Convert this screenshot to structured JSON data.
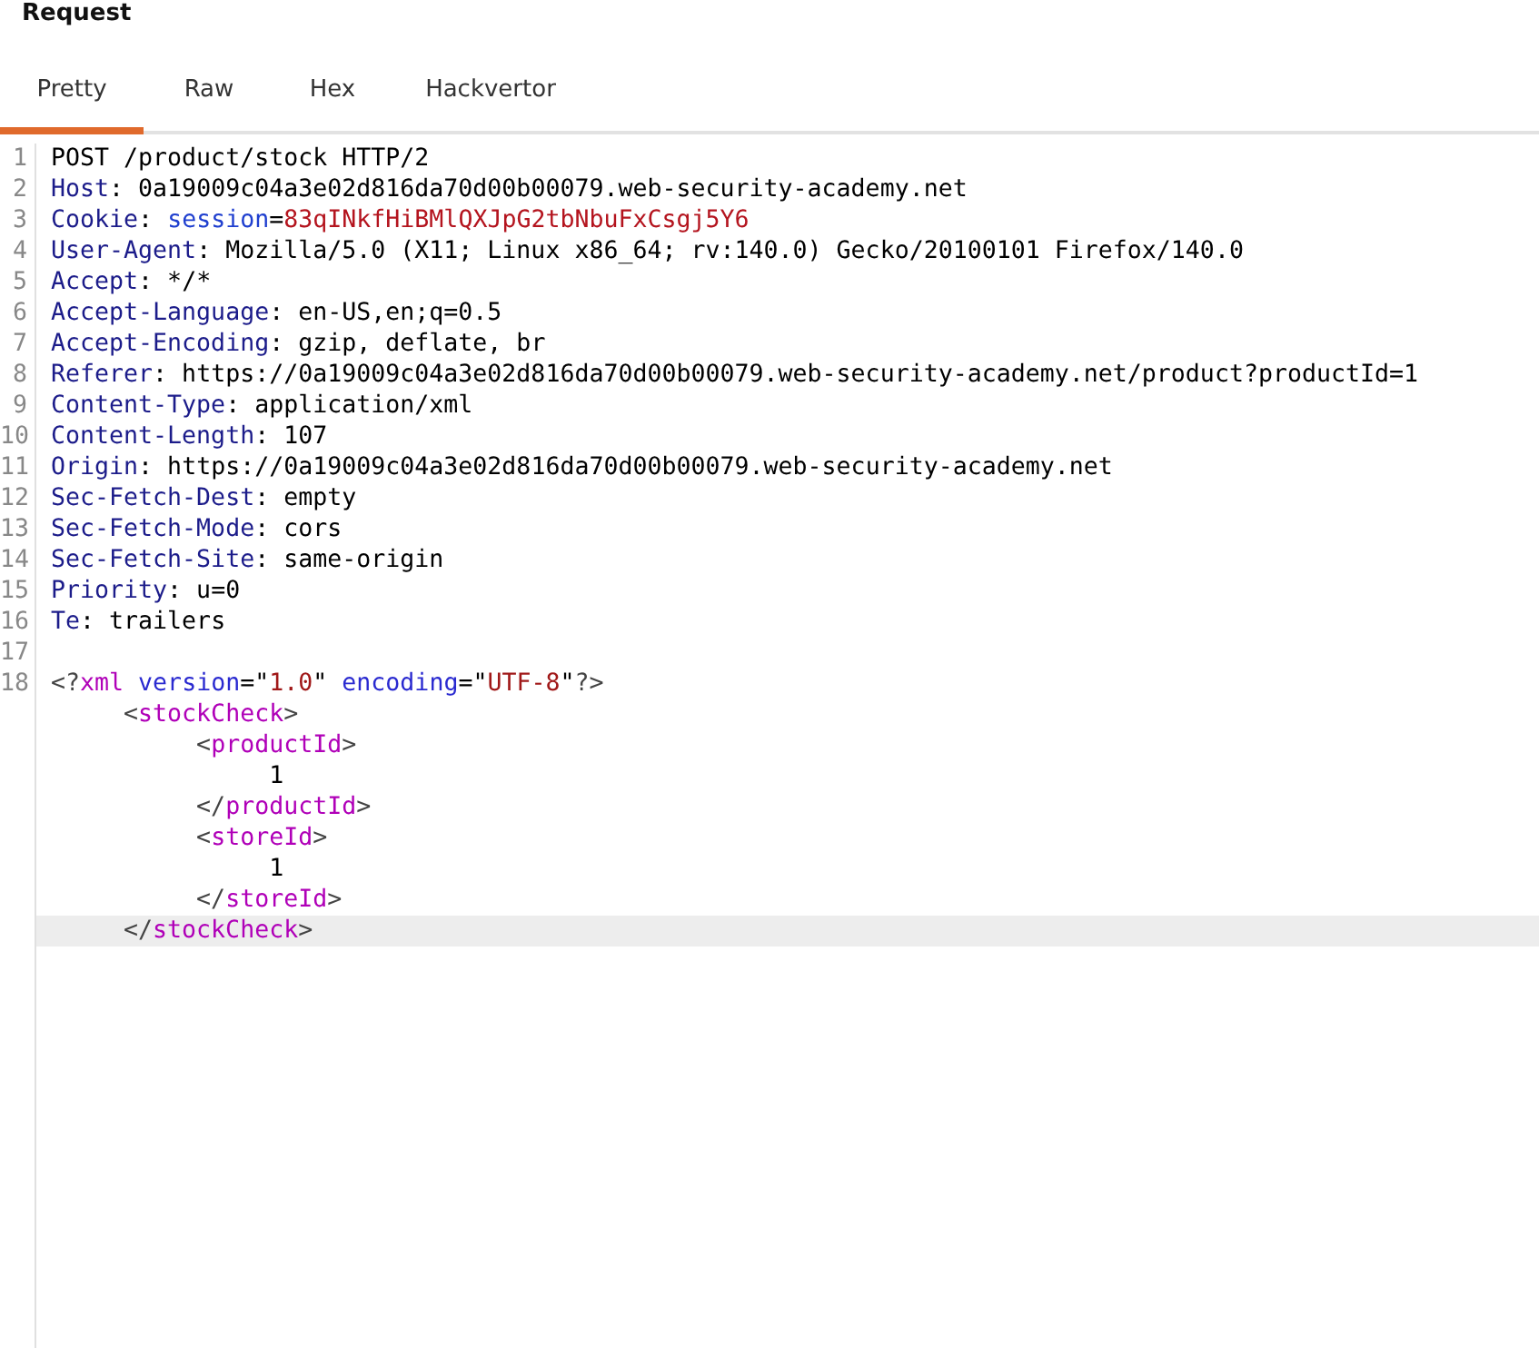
{
  "panel": {
    "title": "Request"
  },
  "tabs": [
    {
      "label": "Pretty",
      "selected": true
    },
    {
      "label": "Raw",
      "selected": false
    },
    {
      "label": "Hex",
      "selected": false
    },
    {
      "label": "Hackvertor",
      "selected": false
    }
  ],
  "editor": {
    "lines": [
      {
        "number": "1",
        "current": false,
        "tokens": [
          {
            "kind": "plain",
            "text": "POST /product/stock HTTP/2"
          }
        ]
      },
      {
        "number": "2",
        "current": false,
        "tokens": [
          {
            "kind": "key",
            "text": "Host"
          },
          {
            "kind": "plain",
            "text": ": 0a19009c04a3e02d816da70d00b00079.web-security-academy.net"
          }
        ]
      },
      {
        "number": "3",
        "current": false,
        "tokens": [
          {
            "kind": "key",
            "text": "Cookie"
          },
          {
            "kind": "plain",
            "text": ": "
          },
          {
            "kind": "cookie-name",
            "text": "session"
          },
          {
            "kind": "plain",
            "text": "="
          },
          {
            "kind": "cookie-value",
            "text": "83qINkfHiBMlQXJpG2tbNbuFxCsgj5Y6"
          }
        ]
      },
      {
        "number": "4",
        "current": false,
        "tokens": [
          {
            "kind": "key",
            "text": "User-Agent"
          },
          {
            "kind": "plain",
            "text": ": Mozilla/5.0 (X11; Linux x86_64; rv:140.0) Gecko/20100101 Firefox/140.0"
          }
        ]
      },
      {
        "number": "5",
        "current": false,
        "tokens": [
          {
            "kind": "key",
            "text": "Accept"
          },
          {
            "kind": "plain",
            "text": ": */*"
          }
        ]
      },
      {
        "number": "6",
        "current": false,
        "tokens": [
          {
            "kind": "key",
            "text": "Accept-Language"
          },
          {
            "kind": "plain",
            "text": ": en-US,en;q=0.5"
          }
        ]
      },
      {
        "number": "7",
        "current": false,
        "tokens": [
          {
            "kind": "key",
            "text": "Accept-Encoding"
          },
          {
            "kind": "plain",
            "text": ": gzip, deflate, br"
          }
        ]
      },
      {
        "number": "8",
        "current": false,
        "tokens": [
          {
            "kind": "key",
            "text": "Referer"
          },
          {
            "kind": "plain",
            "text": ": https://0a19009c04a3e02d816da70d00b00079.web-security-academy.net/product?productId=1"
          }
        ]
      },
      {
        "number": "9",
        "current": false,
        "tokens": [
          {
            "kind": "key",
            "text": "Content-Type"
          },
          {
            "kind": "plain",
            "text": ": application/xml"
          }
        ]
      },
      {
        "number": "10",
        "current": false,
        "tokens": [
          {
            "kind": "key",
            "text": "Content-Length"
          },
          {
            "kind": "plain",
            "text": ": 107"
          }
        ]
      },
      {
        "number": "11",
        "current": false,
        "tokens": [
          {
            "kind": "key",
            "text": "Origin"
          },
          {
            "kind": "plain",
            "text": ": https://0a19009c04a3e02d816da70d00b00079.web-security-academy.net"
          }
        ]
      },
      {
        "number": "12",
        "current": false,
        "tokens": [
          {
            "kind": "key",
            "text": "Sec-Fetch-Dest"
          },
          {
            "kind": "plain",
            "text": ": empty"
          }
        ]
      },
      {
        "number": "13",
        "current": false,
        "tokens": [
          {
            "kind": "key",
            "text": "Sec-Fetch-Mode"
          },
          {
            "kind": "plain",
            "text": ": cors"
          }
        ]
      },
      {
        "number": "14",
        "current": false,
        "tokens": [
          {
            "kind": "key",
            "text": "Sec-Fetch-Site"
          },
          {
            "kind": "plain",
            "text": ": same-origin"
          }
        ]
      },
      {
        "number": "15",
        "current": false,
        "tokens": [
          {
            "kind": "key",
            "text": "Priority"
          },
          {
            "kind": "plain",
            "text": ": u=0"
          }
        ]
      },
      {
        "number": "16",
        "current": false,
        "tokens": [
          {
            "kind": "key",
            "text": "Te"
          },
          {
            "kind": "plain",
            "text": ": trailers"
          }
        ]
      },
      {
        "number": "17",
        "current": false
      },
      {
        "number": "18",
        "current": false,
        "tokens": [
          {
            "kind": "bracket",
            "text": "<?"
          },
          {
            "kind": "tag",
            "text": "xml"
          },
          {
            "kind": "attr",
            "text": "version"
          },
          {
            "kind": "plain",
            "text": "=\""
          },
          {
            "kind": "string",
            "text": "1.0"
          },
          {
            "kind": "plain",
            "text": "\" "
          },
          {
            "kind": "attr",
            "text": "encoding"
          },
          {
            "kind": "plain",
            "text": "=\""
          },
          {
            "kind": "string",
            "text": "UTF-8"
          },
          {
            "kind": "plain",
            "text": "\""
          },
          {
            "kind": "bracket",
            "text": "?>"
          }
        ]
      }
    ],
    "xml": [
      {
        "open": {
          "current": false,
          "tokens": [
            {
              "kind": "bracket",
              "text": "<"
            },
            {
              "kind": "tag",
              "text": "stockCheck"
            },
            {
              "kind": "bracket",
              "text": ">"
            }
          ]
        },
        "children": [
          {
            "open": {
              "current": false,
              "tokens": [
                {
                  "kind": "bracket",
                  "text": "<"
                },
                {
                  "kind": "tag",
                  "text": "productId"
                },
                {
                  "kind": "bracket",
                  "text": ">"
                }
              ]
            },
            "children": [
              {
                "line": {
                  "current": false,
                  "tokens": [
                    {
                      "kind": "plain",
                      "text": "1"
                    }
                  ]
                }
              }
            ],
            "close": {
              "current": false,
              "tokens": [
                {
                  "kind": "bracket",
                  "text": "</"
                },
                {
                  "kind": "tag",
                  "text": "productId"
                },
                {
                  "kind": "bracket",
                  "text": ">"
                }
              ]
            }
          },
          {
            "open": {
              "current": false,
              "tokens": [
                {
                  "kind": "bracket",
                  "text": "<"
                },
                {
                  "kind": "tag",
                  "text": "storeId"
                },
                {
                  "kind": "bracket",
                  "text": ">"
                }
              ]
            },
            "children": [
              {
                "line": {
                  "current": false,
                  "tokens": [
                    {
                      "kind": "plain",
                      "text": "1"
                    }
                  ]
                }
              }
            ],
            "close": {
              "current": false,
              "tokens": [
                {
                  "kind": "bracket",
                  "text": "</"
                },
                {
                  "kind": "tag",
                  "text": "storeId"
                },
                {
                  "kind": "bracket",
                  "text": ">"
                }
              ]
            }
          }
        ],
        "close": {
          "current": true,
          "tokens": [
            {
              "kind": "bracket",
              "text": "</"
            },
            {
              "kind": "tag",
              "text": "stockCheck"
            },
            {
              "kind": "bracket",
              "text": ">"
            }
          ]
        }
      }
    ]
  }
}
